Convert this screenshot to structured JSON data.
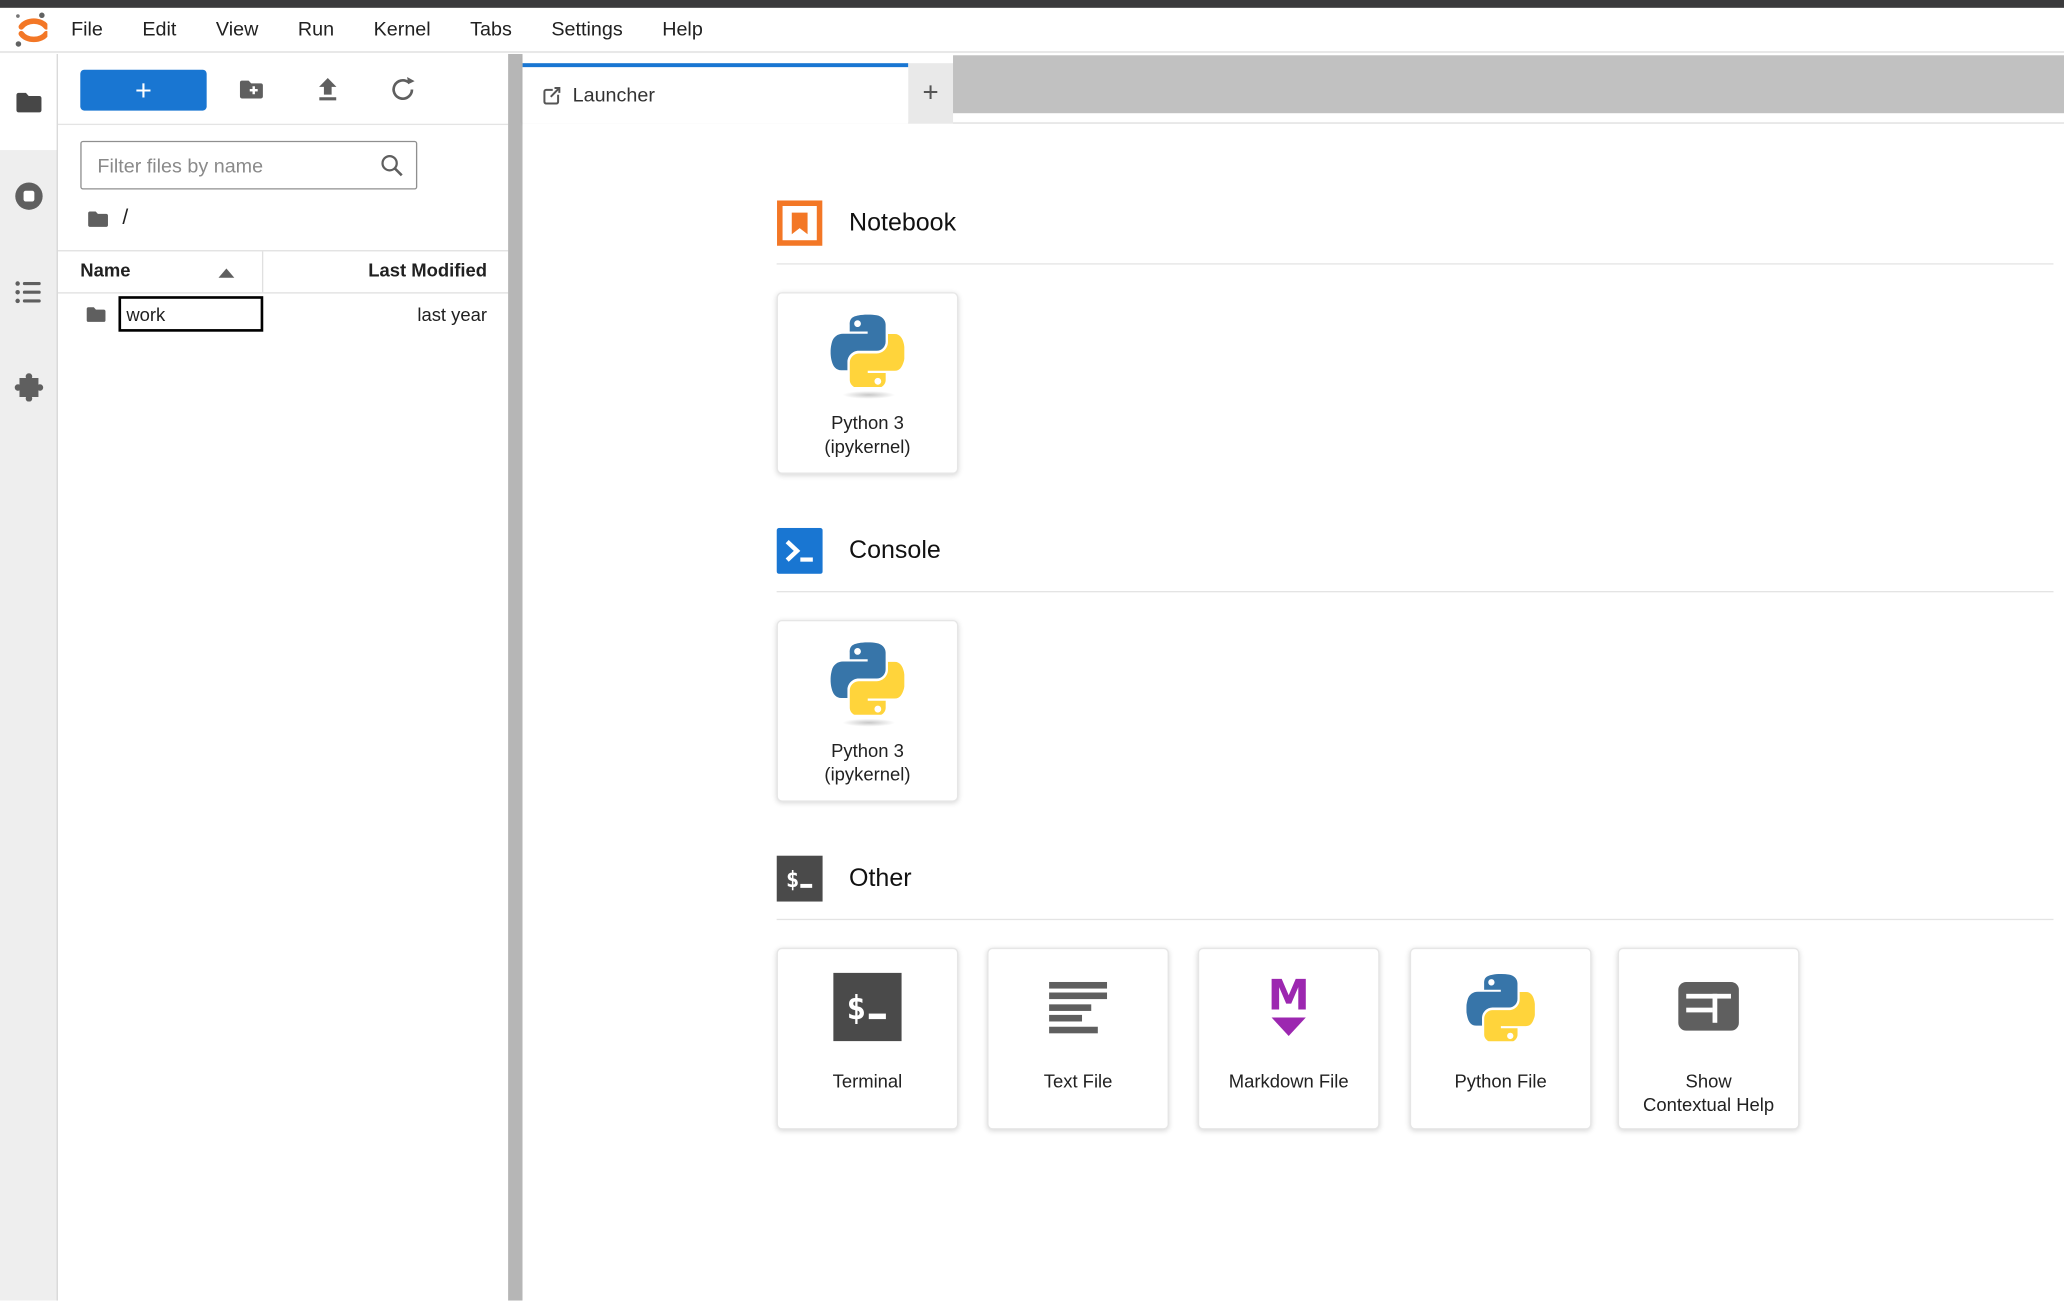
{
  "menu_bar": {
    "items": [
      "File",
      "Edit",
      "View",
      "Run",
      "Kernel",
      "Tabs",
      "Settings",
      "Help"
    ]
  },
  "file_browser": {
    "new_launcher_button": "+",
    "search": {
      "placeholder": "Filter files by name"
    },
    "breadcrumb": "/",
    "table": {
      "columns": [
        "Name",
        "Last Modified"
      ]
    },
    "rows": [
      {
        "name": "work",
        "modified": "last year"
      }
    ]
  },
  "tab_bar": {
    "active_tab": "Launcher",
    "new_tab_button": "+"
  },
  "launcher": {
    "sections": [
      {
        "title": "Notebook",
        "cards": [
          {
            "line1": "Python 3",
            "line2": "(ipykernel)"
          }
        ]
      },
      {
        "title": "Console",
        "cards": [
          {
            "line1": "Python 3",
            "line2": "(ipykernel)"
          }
        ]
      },
      {
        "title": "Other",
        "cards": [
          {
            "line1": "Terminal"
          },
          {
            "line1": "Text File"
          },
          {
            "line1": "Markdown File"
          },
          {
            "line1": "Python File"
          },
          {
            "line1": "Show",
            "line2": "Contextual Help"
          }
        ]
      }
    ]
  },
  "colors": {
    "accent_blue": "#1976d2",
    "jupyter_orange": "#f37726",
    "markdown_purple": "#9c27b0",
    "python_blue": "#3775a9",
    "python_yellow": "#ffd43b",
    "icon_gray": "#5f5f5f",
    "tabbar_gray": "#c1c1c1",
    "top_strip": "#3a3a3c"
  }
}
